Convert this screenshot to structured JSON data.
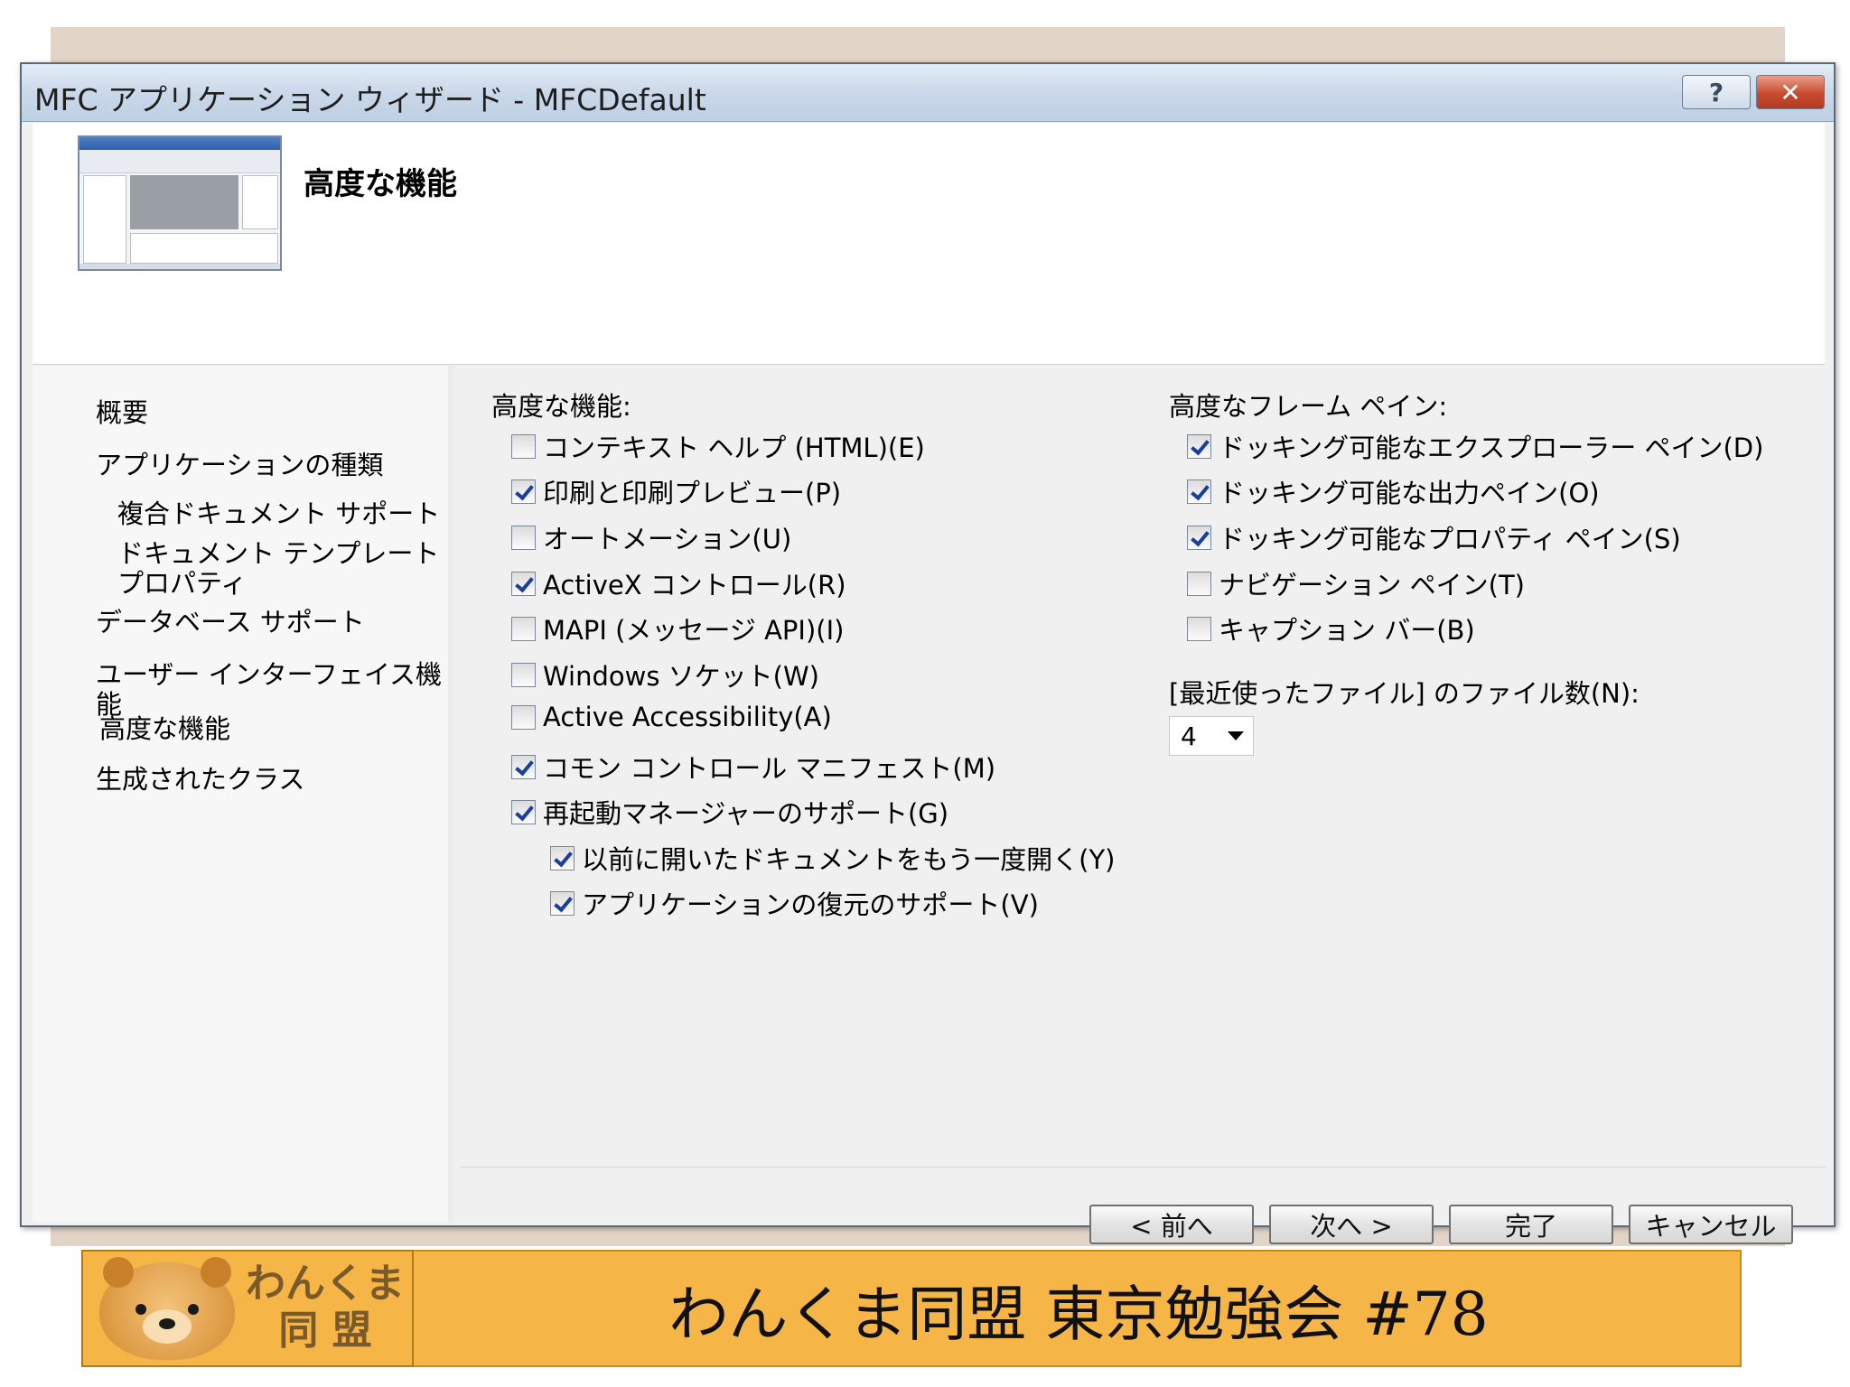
{
  "window": {
    "title": "MFC アプリケーション ウィザード - MFCDefault",
    "help_label": "?",
    "close_label": "✕"
  },
  "header": {
    "heading": "高度な機能"
  },
  "nav": {
    "items": [
      "概要",
      "アプリケーションの種類",
      "複合ドキュメント サポート",
      "ドキュメント テンプレート プロパティ",
      "データベース サポート",
      "ユーザー インターフェイス機能",
      "高度な機能",
      "生成されたクラス"
    ]
  },
  "advanced": {
    "label": "高度な機能:",
    "options": [
      {
        "label": "コンテキスト ヘルプ (HTML)(E)",
        "checked": false
      },
      {
        "label": "印刷と印刷プレビュー(P)",
        "checked": true
      },
      {
        "label": "オートメーション(U)",
        "checked": false
      },
      {
        "label": "ActiveX コントロール(R)",
        "checked": true
      },
      {
        "label": "MAPI (メッセージ API)(I)",
        "checked": false
      },
      {
        "label": "Windows ソケット(W)",
        "checked": false
      },
      {
        "label": "Active Accessibility(A)",
        "checked": false
      },
      {
        "label": "コモン コントロール マニフェスト(M)",
        "checked": true
      },
      {
        "label": "再起動マネージャーのサポート(G)",
        "checked": true
      },
      {
        "label": "以前に開いたドキュメントをもう一度開く(Y)",
        "checked": true
      },
      {
        "label": "アプリケーションの復元のサポート(V)",
        "checked": true
      }
    ]
  },
  "frame_panes": {
    "label": "高度なフレーム ペイン:",
    "options": [
      {
        "label": "ドッキング可能なエクスプローラー ペイン(D)",
        "checked": true
      },
      {
        "label": "ドッキング可能な出力ペイン(O)",
        "checked": true
      },
      {
        "label": "ドッキング可能なプロパティ ペイン(S)",
        "checked": true
      },
      {
        "label": "ナビゲーション ペイン(T)",
        "checked": false
      },
      {
        "label": "キャプション バー(B)",
        "checked": false
      }
    ]
  },
  "recent_files": {
    "label": "[最近使ったファイル] のファイル数(N):",
    "value": "4"
  },
  "buttons": {
    "prev": "< 前へ",
    "next": "次へ >",
    "finish": "完了",
    "cancel": "キャンセル"
  },
  "footer": {
    "logo_text_1": "わんくま",
    "logo_text_2": "同 盟",
    "caption": "わんくま同盟 東京勉強会 #78"
  },
  "colors": {
    "footer_bar": "#f5b547",
    "title_gradient": "#c8d7e8",
    "check_mark": "#1a3e9c"
  }
}
